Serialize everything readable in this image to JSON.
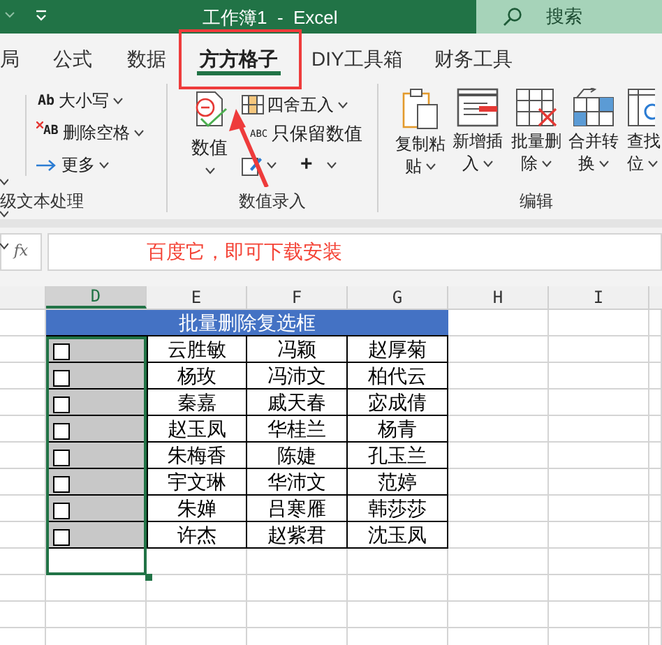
{
  "window": {
    "title": "工作簿1  -  Excel",
    "search_placeholder": "搜索"
  },
  "tabs": [
    {
      "label": "局",
      "selected": false
    },
    {
      "label": "公式",
      "selected": false
    },
    {
      "label": "数据",
      "selected": false
    },
    {
      "label": "方方格子",
      "selected": true
    },
    {
      "label": "DIY工具箱",
      "selected": false
    },
    {
      "label": "财务工具",
      "selected": false
    }
  ],
  "ribbon": {
    "groups": [
      {
        "label": "级文本处理",
        "rows": [
          {
            "icon_text": "Ab",
            "label": "大小写"
          },
          {
            "icon_text": "AB",
            "label": "删除空格"
          },
          {
            "label": "更多"
          }
        ]
      },
      {
        "label": "数值录入",
        "big_button": "数值",
        "rows": [
          {
            "label": "四舍五入"
          },
          {
            "icon_text": "ABC",
            "label": "只保留数值"
          }
        ],
        "plus": "+"
      },
      {
        "label": "编辑",
        "buttons": [
          {
            "lines": [
              "复制粘",
              "贴"
            ]
          },
          {
            "lines": [
              "新增插",
              "入"
            ]
          },
          {
            "lines": [
              "批量删",
              "除"
            ]
          },
          {
            "lines": [
              "合并转",
              "换"
            ]
          },
          {
            "lines": [
              "查找",
              "位"
            ]
          }
        ]
      }
    ]
  },
  "formula_bar": {
    "function_label": "fx",
    "value": "百度它，即可下载安装"
  },
  "columns": [
    {
      "label": "D",
      "selected": true
    },
    {
      "label": "E",
      "selected": false
    },
    {
      "label": "F",
      "selected": false
    },
    {
      "label": "G",
      "selected": false
    },
    {
      "label": "H",
      "selected": false
    },
    {
      "label": "I",
      "selected": false
    }
  ],
  "table": {
    "title": "批量删除复选框",
    "rows": [
      {
        "checked": false,
        "names": [
          "云胜敏",
          "冯颖",
          "赵厚菊"
        ]
      },
      {
        "checked": false,
        "names": [
          "杨玫",
          "冯沛文",
          "柏代云"
        ]
      },
      {
        "checked": false,
        "names": [
          "秦嘉",
          "戚天春",
          "宓成倩"
        ]
      },
      {
        "checked": false,
        "names": [
          "赵玉凤",
          "华桂兰",
          "杨青"
        ]
      },
      {
        "checked": false,
        "names": [
          "朱梅香",
          "陈婕",
          "孔玉兰"
        ]
      },
      {
        "checked": false,
        "names": [
          "宇文琳",
          "华沛文",
          "范婷"
        ]
      },
      {
        "checked": false,
        "names": [
          "朱婵",
          "吕寒雁",
          "韩莎莎"
        ]
      },
      {
        "checked": false,
        "names": [
          "许杰",
          "赵紫君",
          "沈玉凤"
        ]
      }
    ]
  }
}
